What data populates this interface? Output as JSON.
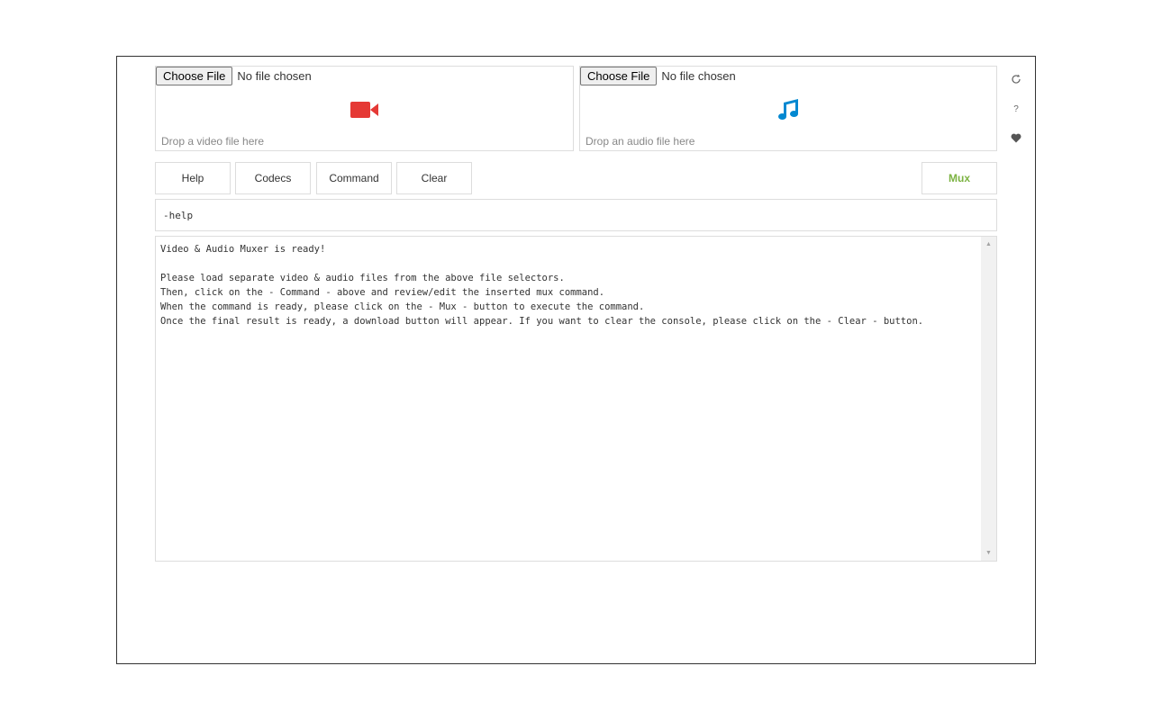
{
  "video_input": {
    "choose_label": "Choose File",
    "status": "No file chosen",
    "drop_hint": "Drop a video file here",
    "icon": "video-camera-icon",
    "icon_color": "#e53935"
  },
  "audio_input": {
    "choose_label": "Choose File",
    "status": "No file chosen",
    "drop_hint": "Drop an audio file here",
    "icon": "music-note-icon",
    "icon_color": "#0288d1"
  },
  "toolbar": {
    "help_label": "Help",
    "codecs_label": "Codecs",
    "command_label": "Command",
    "clear_label": "Clear",
    "mux_label": "Mux",
    "mux_color": "#7cb342"
  },
  "command": {
    "value": "-help"
  },
  "console": {
    "text": "Video & Audio Muxer is ready!\n\nPlease load separate video & audio files from the above file selectors.\nThen, click on the - Command - above and review/edit the inserted mux command.\nWhen the command is ready, please click on the - Mux - button to execute the command.\nOnce the final result is ready, a download button will appear. If you want to clear the console, please click on the - Clear - button."
  },
  "sidebar": {
    "icons": [
      "reload-icon",
      "question-icon",
      "heart-icon"
    ],
    "question_glyph": "?"
  }
}
